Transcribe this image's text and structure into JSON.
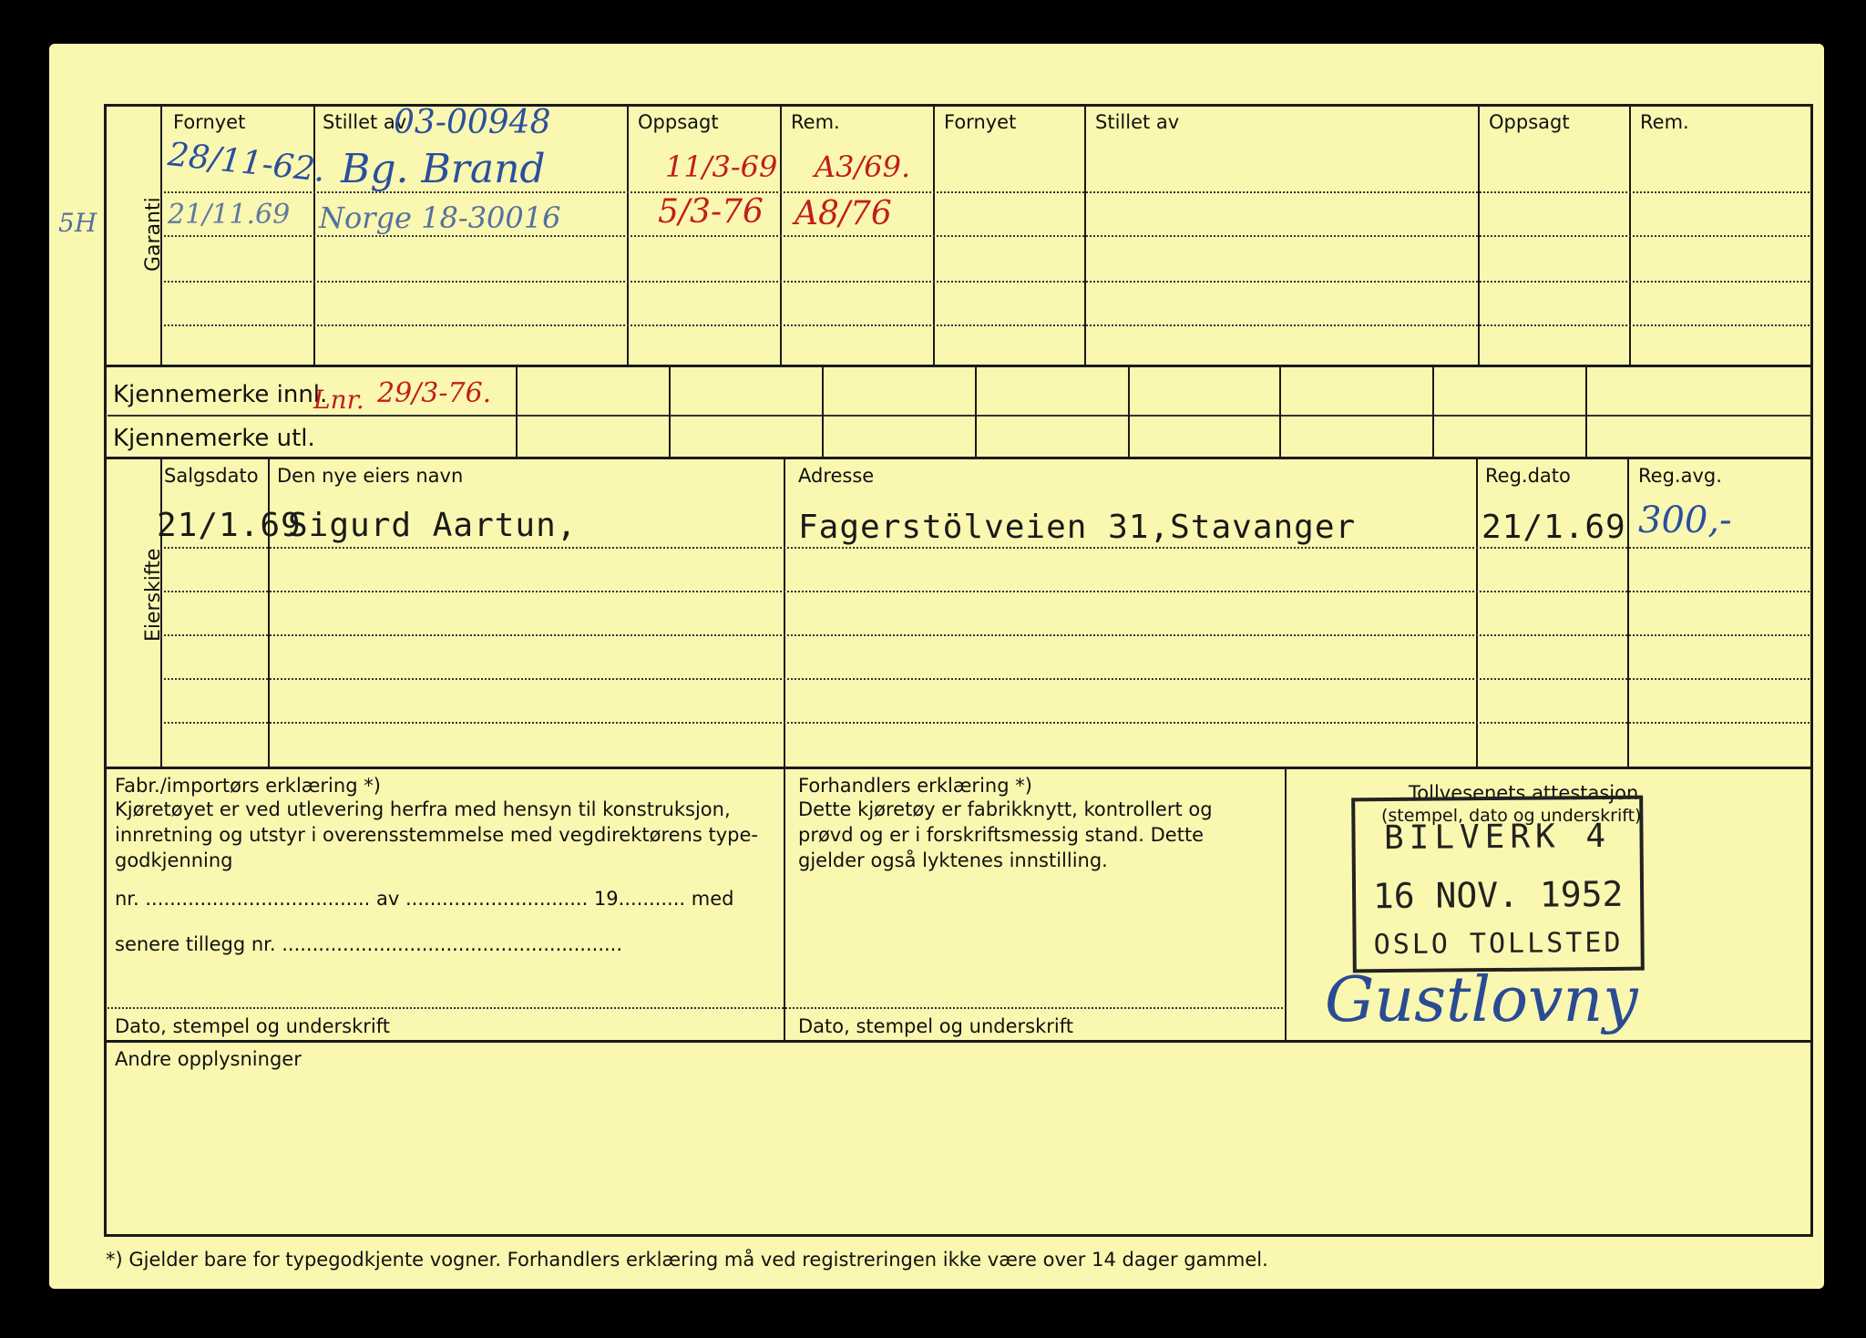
{
  "garanti": {
    "side_label": "Garanti",
    "headers": [
      "Fornyet",
      "Stillet av",
      "Oppsagt",
      "Rem.",
      "Fornyet",
      "Stillet av",
      "Oppsagt",
      "Rem."
    ],
    "handwritten": {
      "stillet_av_no": "03-00948",
      "fornyet_1": "28/11-62.",
      "stillet_av_1": "Bg. Brand",
      "oppsagt_1": "11/3-69",
      "rem_1": "A3/69.",
      "margin_note": "5H",
      "fornyet_2": "21/11.69",
      "stillet_av_2": "Norge 18-30016",
      "oppsagt_2": "5/3-76",
      "rem_2": "A8/76"
    }
  },
  "kjennemerke": {
    "innl_label": "Kjennemerke innl.",
    "utl_label": "Kjennemerke utl.",
    "innl_hand_1": "Lnr.",
    "innl_hand_2": "29/3-76."
  },
  "eierskifte": {
    "side_label": "Eierskifte",
    "headers": {
      "salgsdato": "Salgsdato",
      "navn": "Den nye eiers navn",
      "adresse": "Adresse",
      "regdato": "Reg.dato",
      "regavg": "Reg.avg."
    },
    "row1": {
      "salgsdato": "21/1.69",
      "navn": "Sigurd Aartun,",
      "adresse": "Fagerstölveien 31,Stavanger",
      "regdato": "21/1.69",
      "regavg": "300,-"
    }
  },
  "declarations": {
    "fabr_title": "Fabr./importørs erklæring *)",
    "fabr_text": [
      "Kjøretøyet er ved utlevering herfra med hensyn til konstruksjon,",
      "innretning og utstyr i overensstemmelse med vegdirektørens type-",
      "godkjenning"
    ],
    "fabr_line_nr": "nr. ..................................... av .............................. 19........... med",
    "fabr_line_tillegg": "senere tillegg nr. ........................................................",
    "fabr_footer": "Dato, stempel og underskrift",
    "forh_title": "Forhandlers erklæring *)",
    "forh_text": [
      "Dette kjøretøy er fabrikknytt, kontrollert og",
      "prøvd og er i forskriftsmessig stand. Dette",
      "gjelder også lyktenes innstilling."
    ],
    "forh_footer": "Dato, stempel og underskrift",
    "toll_title": "Tollvesenets attestasjon",
    "toll_sub": "(stempel, dato og underskrift)",
    "stamp_line1": "BILVERK 4",
    "stamp_line2": "16 NOV. 1952",
    "stamp_line3": "OSLO TOLLSTED",
    "signature": "Gustlovny"
  },
  "andre": {
    "label": "Andre opplysninger"
  },
  "footnote": "*)  Gjelder bare for typegodkjente vogner.  Forhandlers erklæring må ved registreringen ikke være over 14 dager gammel."
}
